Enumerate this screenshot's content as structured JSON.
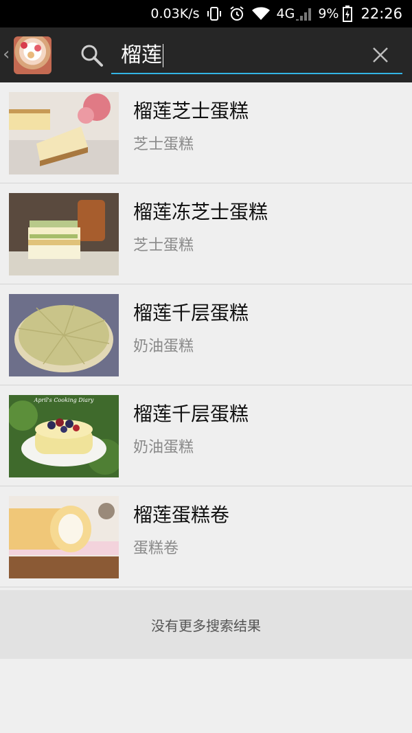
{
  "status_bar": {
    "speed": "0.03K/s",
    "network": "4G",
    "battery": "9%",
    "time": "22:26"
  },
  "toolbar": {
    "search_query": "榴莲"
  },
  "results": [
    {
      "title": "榴莲芝士蛋糕",
      "category": "芝士蛋糕"
    },
    {
      "title": "榴莲冻芝士蛋糕",
      "category": "芝士蛋糕"
    },
    {
      "title": "榴莲千层蛋糕",
      "category": "奶油蛋糕"
    },
    {
      "title": "榴莲千层蛋糕",
      "category": "奶油蛋糕"
    },
    {
      "title": "榴莲蛋糕卷",
      "category": "蛋糕卷"
    }
  ],
  "thumbnail_watermark": "April's Cooking Diary",
  "footer_text": "没有更多搜索结果"
}
